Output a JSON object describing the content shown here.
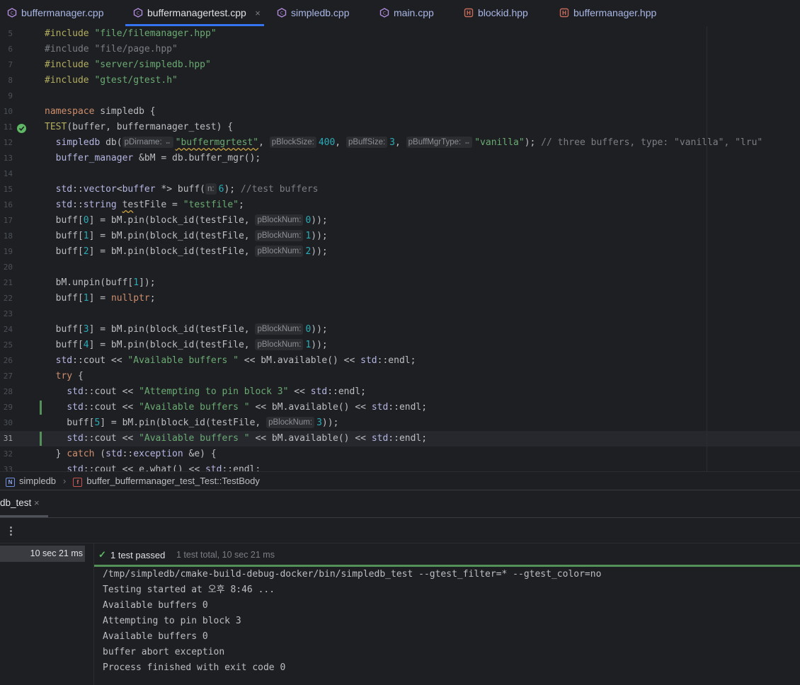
{
  "tabs": [
    {
      "label": "buffermanager.cpp",
      "type": "cpp",
      "active": false
    },
    {
      "label": "buffermanagertest.cpp",
      "type": "cpp",
      "active": true
    },
    {
      "label": "simpledb.cpp",
      "type": "cpp",
      "active": false
    },
    {
      "label": "main.cpp",
      "type": "cpp",
      "active": false
    },
    {
      "label": "blockid.hpp",
      "type": "hpp",
      "active": false
    },
    {
      "label": "buffermanager.hpp",
      "type": "hpp",
      "active": false
    }
  ],
  "tab_close_glyph": "×",
  "editor": {
    "line_numbers": [
      "5",
      "6",
      "7",
      "8",
      "9",
      "10",
      "11",
      "12",
      "13",
      "14",
      "15",
      "16",
      "17",
      "18",
      "19",
      "20",
      "21",
      "22",
      "23",
      "24",
      "25",
      "26",
      "27",
      "28",
      "29",
      "30",
      "31",
      "32",
      "33"
    ],
    "current_line": "31",
    "hints": {
      "pDirname": "pDirname:",
      "pBlockSize": "pBlockSize:",
      "pBuffSize": "pBuffSize:",
      "pBuffMgrType": "pBuffMgrType:",
      "n": "n:",
      "pBlockNum": "pBlockNum:"
    }
  },
  "breadcrumb": {
    "namespace_badge": "N",
    "namespace": "simpledb",
    "function_badge": "f",
    "function": "buffer_buffermanager_test_Test::TestBody"
  },
  "run": {
    "tab_label": "db_test",
    "tab_close_glyph": "×",
    "menu_glyph": "⋮",
    "tree_time": "10 sec 21 ms",
    "status_passed": "1 test passed",
    "status_total": "1 test total, 10 sec 21 ms",
    "console": [
      "/tmp/simpledb/cmake-build-debug-docker/bin/simpledb_test --gtest_filter=* --gtest_color=no",
      "Testing started at 오후 8:46 ...",
      "Available buffers 0",
      "Attempting to pin block 3",
      "Available buffers 0",
      "buffer abort exception",
      "Process finished with exit code 0"
    ]
  },
  "colors": {
    "accent": "#3574f0",
    "success": "#5fb865",
    "string": "#6aab73",
    "keyword": "#cf8e6d",
    "number": "#2aacb8"
  }
}
